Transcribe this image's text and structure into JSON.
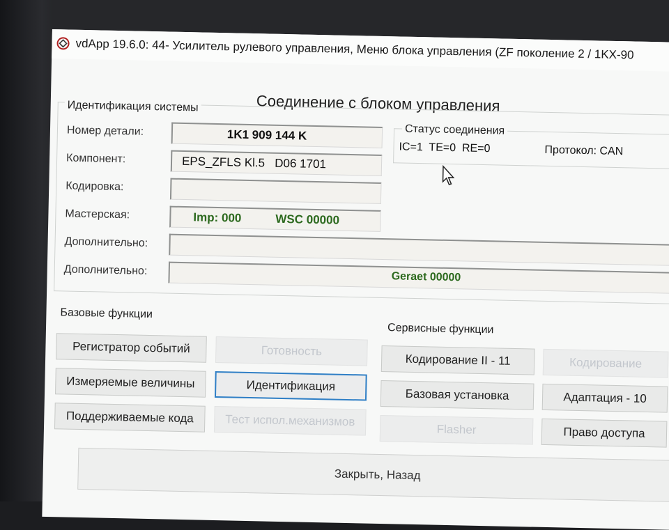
{
  "window": {
    "title": "vdApp 19.6.0: 44- Усилитель рулевого управления,  Меню блока управления (ZF поколение 2 / 1KX-90",
    "heading": "Соединение с блоком управления"
  },
  "identification": {
    "group_title": "Идентификация системы",
    "fields": [
      {
        "label": "Номер детали:",
        "value": "1K1 909 144 K"
      },
      {
        "label": "Компонент:",
        "value": "EPS_ZFLS Kl.5   D06 1701"
      },
      {
        "label": "Кодировка:",
        "value": ""
      },
      {
        "label": "Мастерская:",
        "imp": "Imp: 000",
        "wsc": "WSC 00000"
      },
      {
        "label": "Дополнительно:",
        "value": ""
      },
      {
        "label": "Дополнительно:",
        "value": "Geraet 00000"
      }
    ]
  },
  "status": {
    "title": "Статус соединения",
    "codes": "IC=1  TE=0  RE=0",
    "protocol": "Протокол: CAN"
  },
  "basic_functions": {
    "title": "Базовые функции",
    "buttons": [
      {
        "label": "Регистратор событий"
      },
      {
        "label": "Готовность"
      },
      {
        "label": "Измеряемые величины"
      },
      {
        "label": "Идентификация"
      },
      {
        "label": "Поддерживаемые кода"
      },
      {
        "label": "Тест испол.механизмов"
      }
    ]
  },
  "service_functions": {
    "title": "Сервисные функции",
    "buttons": [
      {
        "label": "Кодирование II - 11"
      },
      {
        "label": "Кодирование"
      },
      {
        "label": "Базовая установка"
      },
      {
        "label": "Адаптация - 10"
      },
      {
        "label": "Flasher"
      },
      {
        "label": "Право доступа"
      }
    ]
  },
  "footer": {
    "close_label": "Закрыть, Назад"
  },
  "colors": {
    "accent_focus": "#2f7fc6",
    "value_green": "#2d6a1f",
    "disabled_text": "#c3c7cd"
  }
}
